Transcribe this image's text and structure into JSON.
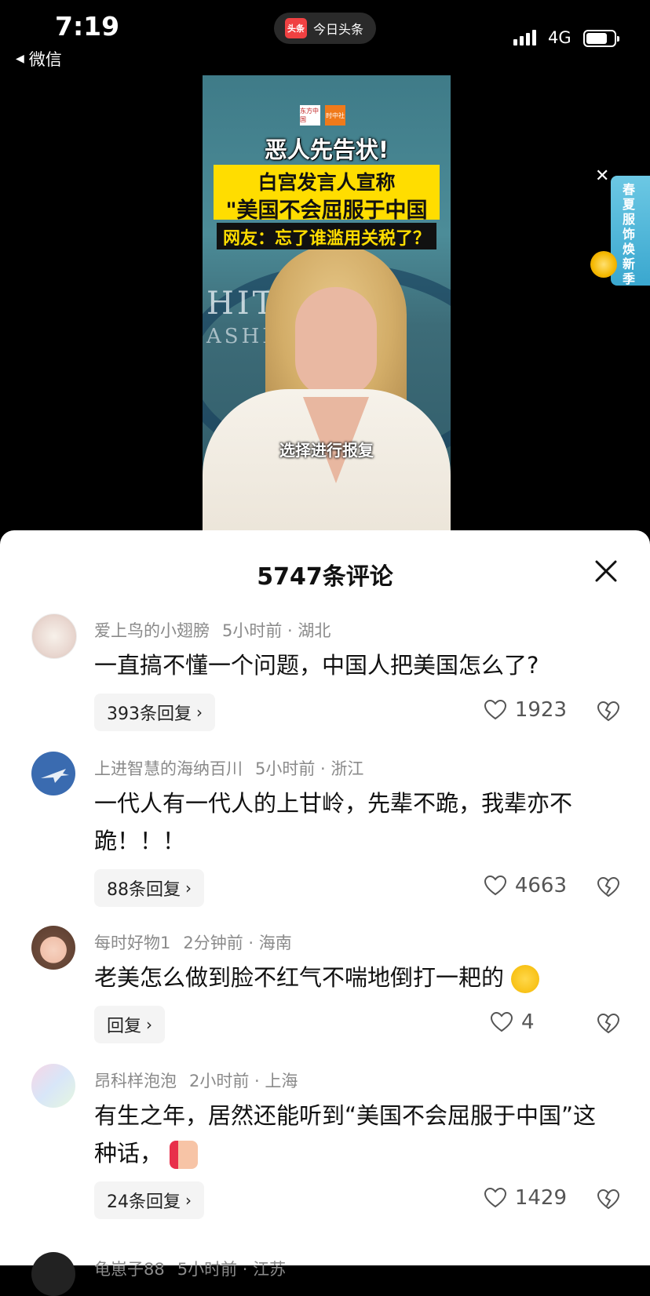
{
  "status": {
    "time": "7:19",
    "back_label": "微信",
    "app_name": "今日头条",
    "app_logo_text": "头条",
    "network": "4G",
    "battery_level": 0.75
  },
  "video": {
    "logo_left": "东方中国",
    "logo_right": "时中社",
    "headline": "恶人先告状!",
    "line2": "白宫发言人宣称",
    "line3": "\"美国不会屈服于中国",
    "line4": "网友：忘了谁滥用关税了？",
    "backdrop_text1": "HITE  SE",
    "backdrop_text2": "ASHIN",
    "subtitle": "选择进行报复"
  },
  "ad": {
    "text": "春夏服饰焕新季"
  },
  "comments_panel": {
    "title": "5747条评论",
    "items": [
      {
        "user": "爱上鸟的小翅膀",
        "time": "5小时前",
        "location": "湖北",
        "text": "一直搞不懂一个问题，中国人把美国怎么了?",
        "replies": "393条回复",
        "likes": "1923"
      },
      {
        "user": "上进智慧的海纳百川",
        "time": "5小时前",
        "location": "浙江",
        "text": "一代人有一代人的上甘岭，先辈不跪，我辈亦不跪！！！",
        "replies": "88条回复",
        "likes": "4663"
      },
      {
        "user": "每时好物1",
        "time": "2分钟前",
        "location": "海南",
        "text": "老美怎么做到脸不红气不喘地倒打一耙的",
        "replies": "回复",
        "likes": "4"
      },
      {
        "user": "昂科样泡泡",
        "time": "2小时前",
        "location": "上海",
        "text": "有生之年，居然还能听到“美国不会屈服于中国”这种话，",
        "replies": "24条回复",
        "likes": "1429"
      },
      {
        "user": "龟崽子88",
        "time": "5小时前",
        "location": "江苏"
      }
    ]
  }
}
